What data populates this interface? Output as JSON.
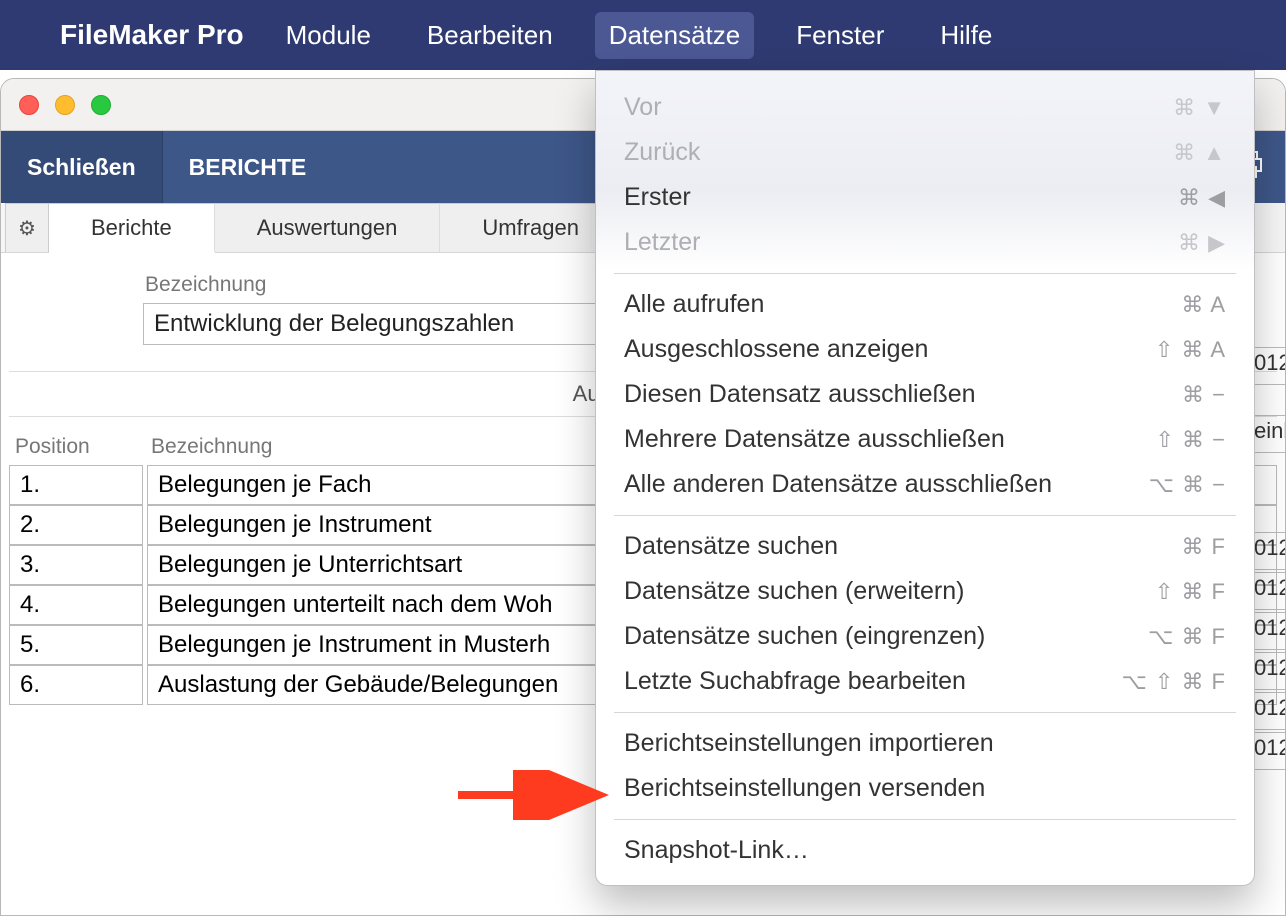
{
  "menubar": {
    "app_name": "FileMaker Pro",
    "items": [
      "Module",
      "Bearbeiten",
      "Datensätze",
      "Fenster",
      "Hilfe"
    ],
    "active_index": 2
  },
  "window": {
    "toolbar_close": "Schließen",
    "toolbar_title": "BERICHTE"
  },
  "subtabs": {
    "items": [
      "Berichte",
      "Auswertungen",
      "Umfragen"
    ],
    "active_index": 0
  },
  "fields": {
    "bezeichnung_label": "Bezeichnung",
    "bezeichnung_value": "Entwicklung der Belegungszahlen"
  },
  "section": {
    "label": "Auswertungen",
    "right_label": "einle",
    "date_frag": "012"
  },
  "columns": {
    "pos": "Position",
    "bez": "Bezeichnung"
  },
  "rows": [
    {
      "pos": "1.",
      "bez": "Belegungen je Fach"
    },
    {
      "pos": "2.",
      "bez": "Belegungen je Instrument"
    },
    {
      "pos": "3.",
      "bez": "Belegungen je Unterrichtsart"
    },
    {
      "pos": "4.",
      "bez": "Belegungen unterteilt nach dem Woh"
    },
    {
      "pos": "5.",
      "bez": "Belegungen je Instrument in Musterh"
    },
    {
      "pos": "6.",
      "bez": "Auslastung der Gebäude/Belegungen"
    }
  ],
  "dropdown": {
    "groups": [
      [
        {
          "label": "Vor",
          "shortcut": "⌘ ▼",
          "disabled": true
        },
        {
          "label": "Zurück",
          "shortcut": "⌘ ▲",
          "disabled": true
        },
        {
          "label": "Erster",
          "shortcut": "⌘ ◀",
          "disabled": false
        },
        {
          "label": "Letzter",
          "shortcut": "⌘ ▶",
          "disabled": true
        }
      ],
      [
        {
          "label": "Alle aufrufen",
          "shortcut": "⌘ A",
          "disabled": false
        },
        {
          "label": "Ausgeschlossene anzeigen",
          "shortcut": "⇧ ⌘ A",
          "disabled": false
        },
        {
          "label": "Diesen Datensatz ausschließen",
          "shortcut": "⌘ −",
          "disabled": false
        },
        {
          "label": "Mehrere Datensätze ausschließen",
          "shortcut": "⇧ ⌘ −",
          "disabled": false
        },
        {
          "label": "Alle anderen Datensätze ausschließen",
          "shortcut": "⌥ ⌘ −",
          "disabled": false
        }
      ],
      [
        {
          "label": "Datensätze suchen",
          "shortcut": "⌘ F",
          "disabled": false
        },
        {
          "label": "Datensätze suchen (erweitern)",
          "shortcut": "⇧ ⌘ F",
          "disabled": false
        },
        {
          "label": "Datensätze suchen (eingrenzen)",
          "shortcut": "⌥ ⌘ F",
          "disabled": false
        },
        {
          "label": "Letzte Suchabfrage bearbeiten",
          "shortcut": "⌥ ⇧ ⌘ F",
          "disabled": false
        }
      ],
      [
        {
          "label": "Berichtseinstellungen importieren",
          "shortcut": "",
          "disabled": false
        },
        {
          "label": "Berichtseinstellungen versenden",
          "shortcut": "",
          "disabled": false
        }
      ],
      [
        {
          "label": "Snapshot-Link…",
          "shortcut": "",
          "disabled": false
        }
      ]
    ]
  }
}
